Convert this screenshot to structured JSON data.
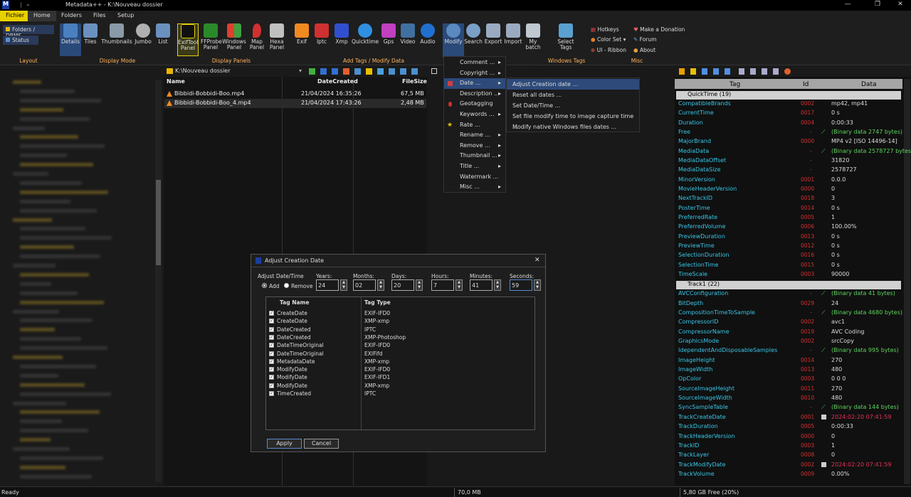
{
  "window": {
    "app_icon_label": "M",
    "qa_separator": "|",
    "qa_dropdown": "⌄",
    "title": "Metadata++ - K:\\Nouveau dossier",
    "minimize": "—",
    "maximize": "❐",
    "close": "✕"
  },
  "menu": {
    "file": "Fichier",
    "tabs": [
      "Home",
      "Folders",
      "Files",
      "Setup"
    ]
  },
  "ribbon": {
    "layout": {
      "folders": "Folders / DBMS",
      "status": "Status",
      "group": "Layout"
    },
    "display_mode": {
      "buttons": [
        "Details",
        "Tiles",
        "Thumbnails",
        "Jumbo",
        "List"
      ],
      "group": "Display Mode"
    },
    "display_panels": {
      "buttons": [
        "ExifTool Panel",
        "FFProbe Panel",
        "Windows Panel",
        "Map Panel",
        "Hexa Panel"
      ],
      "group": "Display Panels"
    },
    "tags": {
      "buttons": [
        "Exif",
        "Iptc",
        "Xmp",
        "Quicktime",
        "Gps",
        "Video",
        "Audio",
        "Modify",
        "Search",
        "Export",
        "Import",
        "My batch"
      ],
      "group": "Add Tags / Modify Data"
    },
    "windows_tags": {
      "button": "Select Tags",
      "group": "Windows Tags"
    },
    "misc": {
      "hotkeys": "Hotkeys",
      "color_set": "Color Set",
      "ui_ribbon": "UI - Ribbon",
      "donate": "Make a Donation",
      "forum": "Forum",
      "about": "About",
      "group": "Misc"
    }
  },
  "path": "K:\\Nouveau dossier",
  "files": {
    "columns": [
      "Name",
      "DateCreated",
      "FileSize"
    ],
    "rows": [
      {
        "name": "Bibbidi-Bobbidi-Boo.mp4",
        "date": "21/04/2024 16:35:26",
        "size": "67,5 MB"
      },
      {
        "name": "Bibbidi-Bobbidi-Boo_4.mp4",
        "date": "21/04/2024 17:43:26",
        "size": "2,48 MB"
      }
    ]
  },
  "modify_menu": [
    "Comment ...",
    "Copyright ...",
    "Date ...",
    "Description ...",
    "Geotagging",
    "Keywords ...",
    "Rate ...",
    "Rename ...",
    "Remove ...",
    "Thumbnail ...",
    "Title ...",
    "Watermark ...",
    "Misc ..."
  ],
  "date_submenu": [
    "Adjust Creation date ...",
    "Reset all dates ...",
    "Set Date/Time ...",
    "Set file modify time to image capture time ...",
    "Modify native Windows files dates ..."
  ],
  "dialog": {
    "title": "Adjust Creation Date",
    "adjust_label": "Adjust Date/Time",
    "add": "Add",
    "remove": "Remove",
    "fields": [
      {
        "label": "Years:",
        "value": "24"
      },
      {
        "label": "Months:",
        "value": "02"
      },
      {
        "label": "Days:",
        "value": "20"
      },
      {
        "label": "Hours:",
        "value": "7"
      },
      {
        "label": "Minutes:",
        "value": "41"
      },
      {
        "label": "Seconds:",
        "value": "59"
      }
    ],
    "table_headers": [
      "Tag Name",
      "Tag Type"
    ],
    "rows": [
      [
        "CreateDate",
        "EXIF-IFD0"
      ],
      [
        "CreateDate",
        "XMP-xmp"
      ],
      [
        "DateCreated",
        "IPTC"
      ],
      [
        "DateCreated",
        "XMP-Photoshop"
      ],
      [
        "DateTimeOriginal",
        "EXIF-IFD0"
      ],
      [
        "DateTimeOriginal",
        "EXIFifd"
      ],
      [
        "MetadataDate",
        "XMP-xmp"
      ],
      [
        "ModifyDate",
        "EXIF-IFD0"
      ],
      [
        "ModifyDate",
        "EXIF-IFD1"
      ],
      [
        "ModifyDate",
        "XMP-xmp"
      ],
      [
        "TimeCreated",
        "IPTC"
      ]
    ],
    "apply": "Apply",
    "cancel": "Cancel",
    "close": "✕"
  },
  "tags": {
    "headers": [
      "Tag",
      "Id",
      "Data"
    ],
    "sections": [
      {
        "title": "QuickTime (19)",
        "rows": [
          [
            "CompatibleBrands",
            "0002",
            "mp42, mp41",
            "n"
          ],
          [
            "CurrentTime",
            "0017",
            "0 s",
            "n"
          ],
          [
            "Duration",
            "0004",
            "0:00:33",
            "n"
          ],
          [
            "Free",
            "-",
            "(Binary data 2747 bytes)",
            "g"
          ],
          [
            "MajorBrand",
            "0000",
            "MP4 v2 [ISO 14496-14]",
            "n"
          ],
          [
            "MediaData",
            "-",
            "(Binary data 2578727 bytes)",
            "g"
          ],
          [
            "MediaDataOffset",
            "-",
            "31820",
            "n"
          ],
          [
            "MediaDataSize",
            "-",
            "2578727",
            "n"
          ],
          [
            "MinorVersion",
            "0001",
            "0.0.0",
            "n"
          ],
          [
            "MovieHeaderVersion",
            "0000",
            "0",
            "n"
          ],
          [
            "NextTrackID",
            "0018",
            "3",
            "n"
          ],
          [
            "PosterTime",
            "0014",
            "0 s",
            "n"
          ],
          [
            "PreferredRate",
            "0005",
            "1",
            "n"
          ],
          [
            "PreferredVolume",
            "0006",
            "100.00%",
            "n"
          ],
          [
            "PreviewDuration",
            "0013",
            "0 s",
            "n"
          ],
          [
            "PreviewTime",
            "0012",
            "0 s",
            "n"
          ],
          [
            "SelectionDuration",
            "0016",
            "0 s",
            "n"
          ],
          [
            "SelectionTime",
            "0015",
            "0 s",
            "n"
          ],
          [
            "TimeScale",
            "0003",
            "90000",
            "n"
          ]
        ]
      },
      {
        "title": "Track1 (22)",
        "rows": [
          [
            "AVCConfiguration",
            "-",
            "(Binary data 41 bytes)",
            "g"
          ],
          [
            "BitDepth",
            "0029",
            "24",
            "n"
          ],
          [
            "CompositionTimeToSample",
            "-",
            "(Binary data 4680 bytes)",
            "g"
          ],
          [
            "CompressorID",
            "0002",
            "avc1",
            "n"
          ],
          [
            "CompressorName",
            "0019",
            "AVC Coding",
            "n"
          ],
          [
            "GraphicsMode",
            "0002",
            "srcCopy",
            "n"
          ],
          [
            "IdependentAndDisposableSamples",
            "-",
            "(Binary data 995 bytes)",
            "g"
          ],
          [
            "ImageHeight",
            "0014",
            "270",
            "n"
          ],
          [
            "ImageWidth",
            "0013",
            "480",
            "n"
          ],
          [
            "OpColor",
            "0003",
            "0 0 0",
            "n"
          ],
          [
            "SourceImageHeight",
            "0011",
            "270",
            "n"
          ],
          [
            "SourceImageWidth",
            "0010",
            "480",
            "n"
          ],
          [
            "SyncSampleTable",
            "-",
            "(Binary data 144 bytes)",
            "g"
          ],
          [
            "TrackCreateDate",
            "0001",
            "2024:02:20 07:41:59",
            "r"
          ],
          [
            "TrackDuration",
            "0005",
            "0:00:33",
            "n"
          ],
          [
            "TrackHeaderVersion",
            "0000",
            "0",
            "n"
          ],
          [
            "TrackID",
            "0003",
            "1",
            "n"
          ],
          [
            "TrackLayer",
            "0008",
            "0",
            "n"
          ],
          [
            "TrackModifyDate",
            "0002",
            "2024:02:20 07:41:59",
            "r"
          ],
          [
            "TrackVolume",
            "0009",
            "0.00%",
            "n"
          ]
        ]
      }
    ]
  },
  "status": {
    "left": "Ready",
    "mid": "70,0 MB",
    "right": "5,80 GB Free (20%)"
  }
}
